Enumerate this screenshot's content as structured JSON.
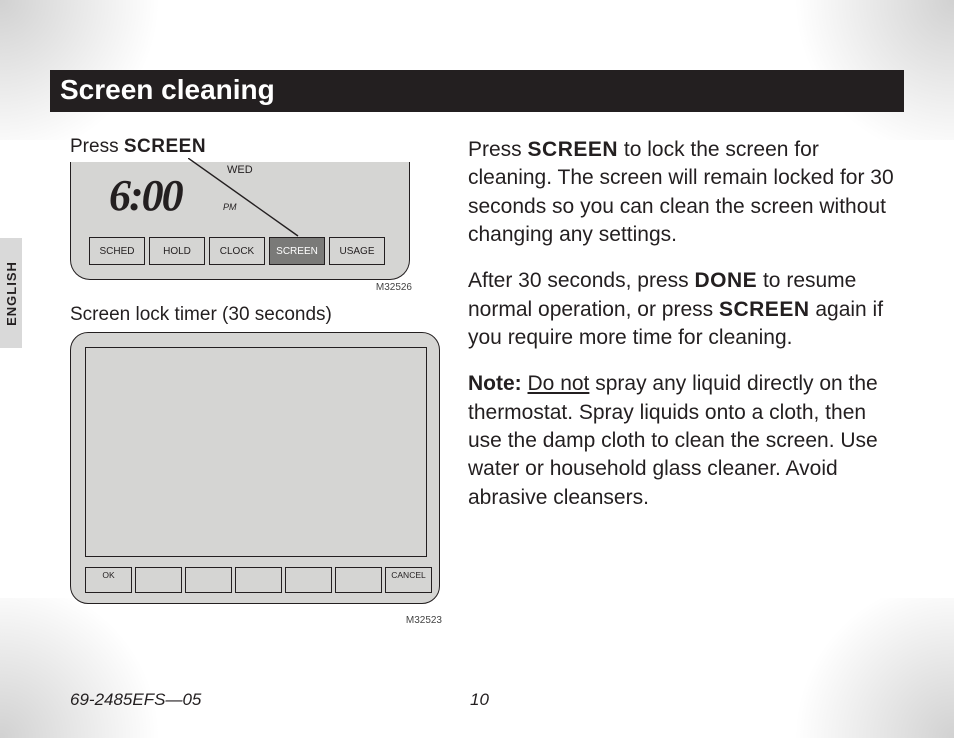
{
  "header": {
    "title": "Screen cleaning"
  },
  "lang_tab": "ENGLISH",
  "left": {
    "instruction_prefix": "Press ",
    "instruction_bold": "SCREEN",
    "fig1": {
      "time": "6:00",
      "pm": "PM",
      "day": "WED",
      "buttons": [
        "SCHED",
        "HOLD",
        "CLOCK",
        "SCREEN",
        "USAGE"
      ],
      "active_index": 3,
      "code": "M32526"
    },
    "caption2": "Screen lock timer (30 seconds)",
    "fig2": {
      "buttons": [
        "OK",
        "",
        "",
        "",
        "",
        "",
        "CANCEL"
      ],
      "code": "M32523"
    }
  },
  "right": {
    "p1_a": "Press ",
    "p1_b": "SCREEN",
    "p1_c": " to lock the screen for cleaning. The screen will remain locked for 30 seconds so you can clean the screen without changing any settings.",
    "p2_a": "After 30 seconds, press ",
    "p2_b": "DONE",
    "p2_c": " to resume normal operation, or press ",
    "p2_d": "SCREEN",
    "p2_e": " again if you require more time for cleaning.",
    "p3_a": "Note:",
    "p3_b": "Do not",
    "p3_c": " spray any liquid directly on the thermostat. Spray liquids onto a cloth, then use the damp cloth to clean the screen. Use water or household glass cleaner. Avoid abrasive cleansers."
  },
  "footer": {
    "docnum": "69-2485EFS—05",
    "pagenum": "10"
  }
}
